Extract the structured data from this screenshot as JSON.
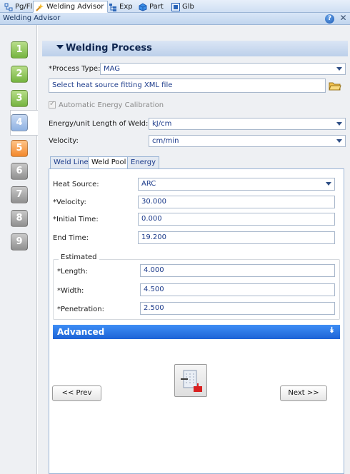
{
  "tabs": [
    {
      "label": "Pg/Fl",
      "icon": "page-tree-icon"
    },
    {
      "label": "Welding Advisor",
      "icon": "welding-torch-icon"
    },
    {
      "label": "Exp",
      "icon": "explorer-tree-icon"
    },
    {
      "label": "Part",
      "icon": "part-icon"
    },
    {
      "label": "Glb",
      "icon": "global-icon"
    }
  ],
  "title": "Welding Advisor",
  "steps": [
    "1",
    "2",
    "3",
    "4",
    "5",
    "6",
    "7",
    "8",
    "9"
  ],
  "section": {
    "label": "Welding Process"
  },
  "process_type": {
    "label": "*Process Type:",
    "value": "MAG"
  },
  "heat_source_file": {
    "placeholder": "Select heat source fitting XML file"
  },
  "auto_calibration": {
    "label": "Automatic Energy Calibration",
    "checked": true,
    "disabled": true
  },
  "energy_unit": {
    "label": "Energy/unit Length of Weld:",
    "value": "kJ/cm"
  },
  "velocity_unit": {
    "label": "Velocity:",
    "value": "cm/min"
  },
  "subtabs": [
    "Weld Line",
    "Weld Pool",
    "Energy"
  ],
  "weld_pool": {
    "heat_source": {
      "label": "Heat Source:",
      "value": "ARC"
    },
    "velocity": {
      "label": "*Velocity:",
      "value": "30.000"
    },
    "initial_time": {
      "label": "*Initial Time:",
      "value": "0.000"
    },
    "end_time": {
      "label": "End Time:",
      "value": "19.200"
    },
    "estimated": {
      "title": "Estimated",
      "length": {
        "label": "*Length:",
        "value": "4.000"
      },
      "width": {
        "label": "*Width:",
        "value": "4.500"
      },
      "penetration": {
        "label": "*Penetration:",
        "value": "2.500"
      }
    }
  },
  "advanced": {
    "label": "Advanced"
  },
  "buttons": {
    "prev": "<< Prev",
    "next": "Next >>"
  },
  "colors": {
    "accent": "#1d63d6",
    "step_done": "#74b33f",
    "step_next": "#f2872b",
    "step_current": "#8eb1e2"
  }
}
